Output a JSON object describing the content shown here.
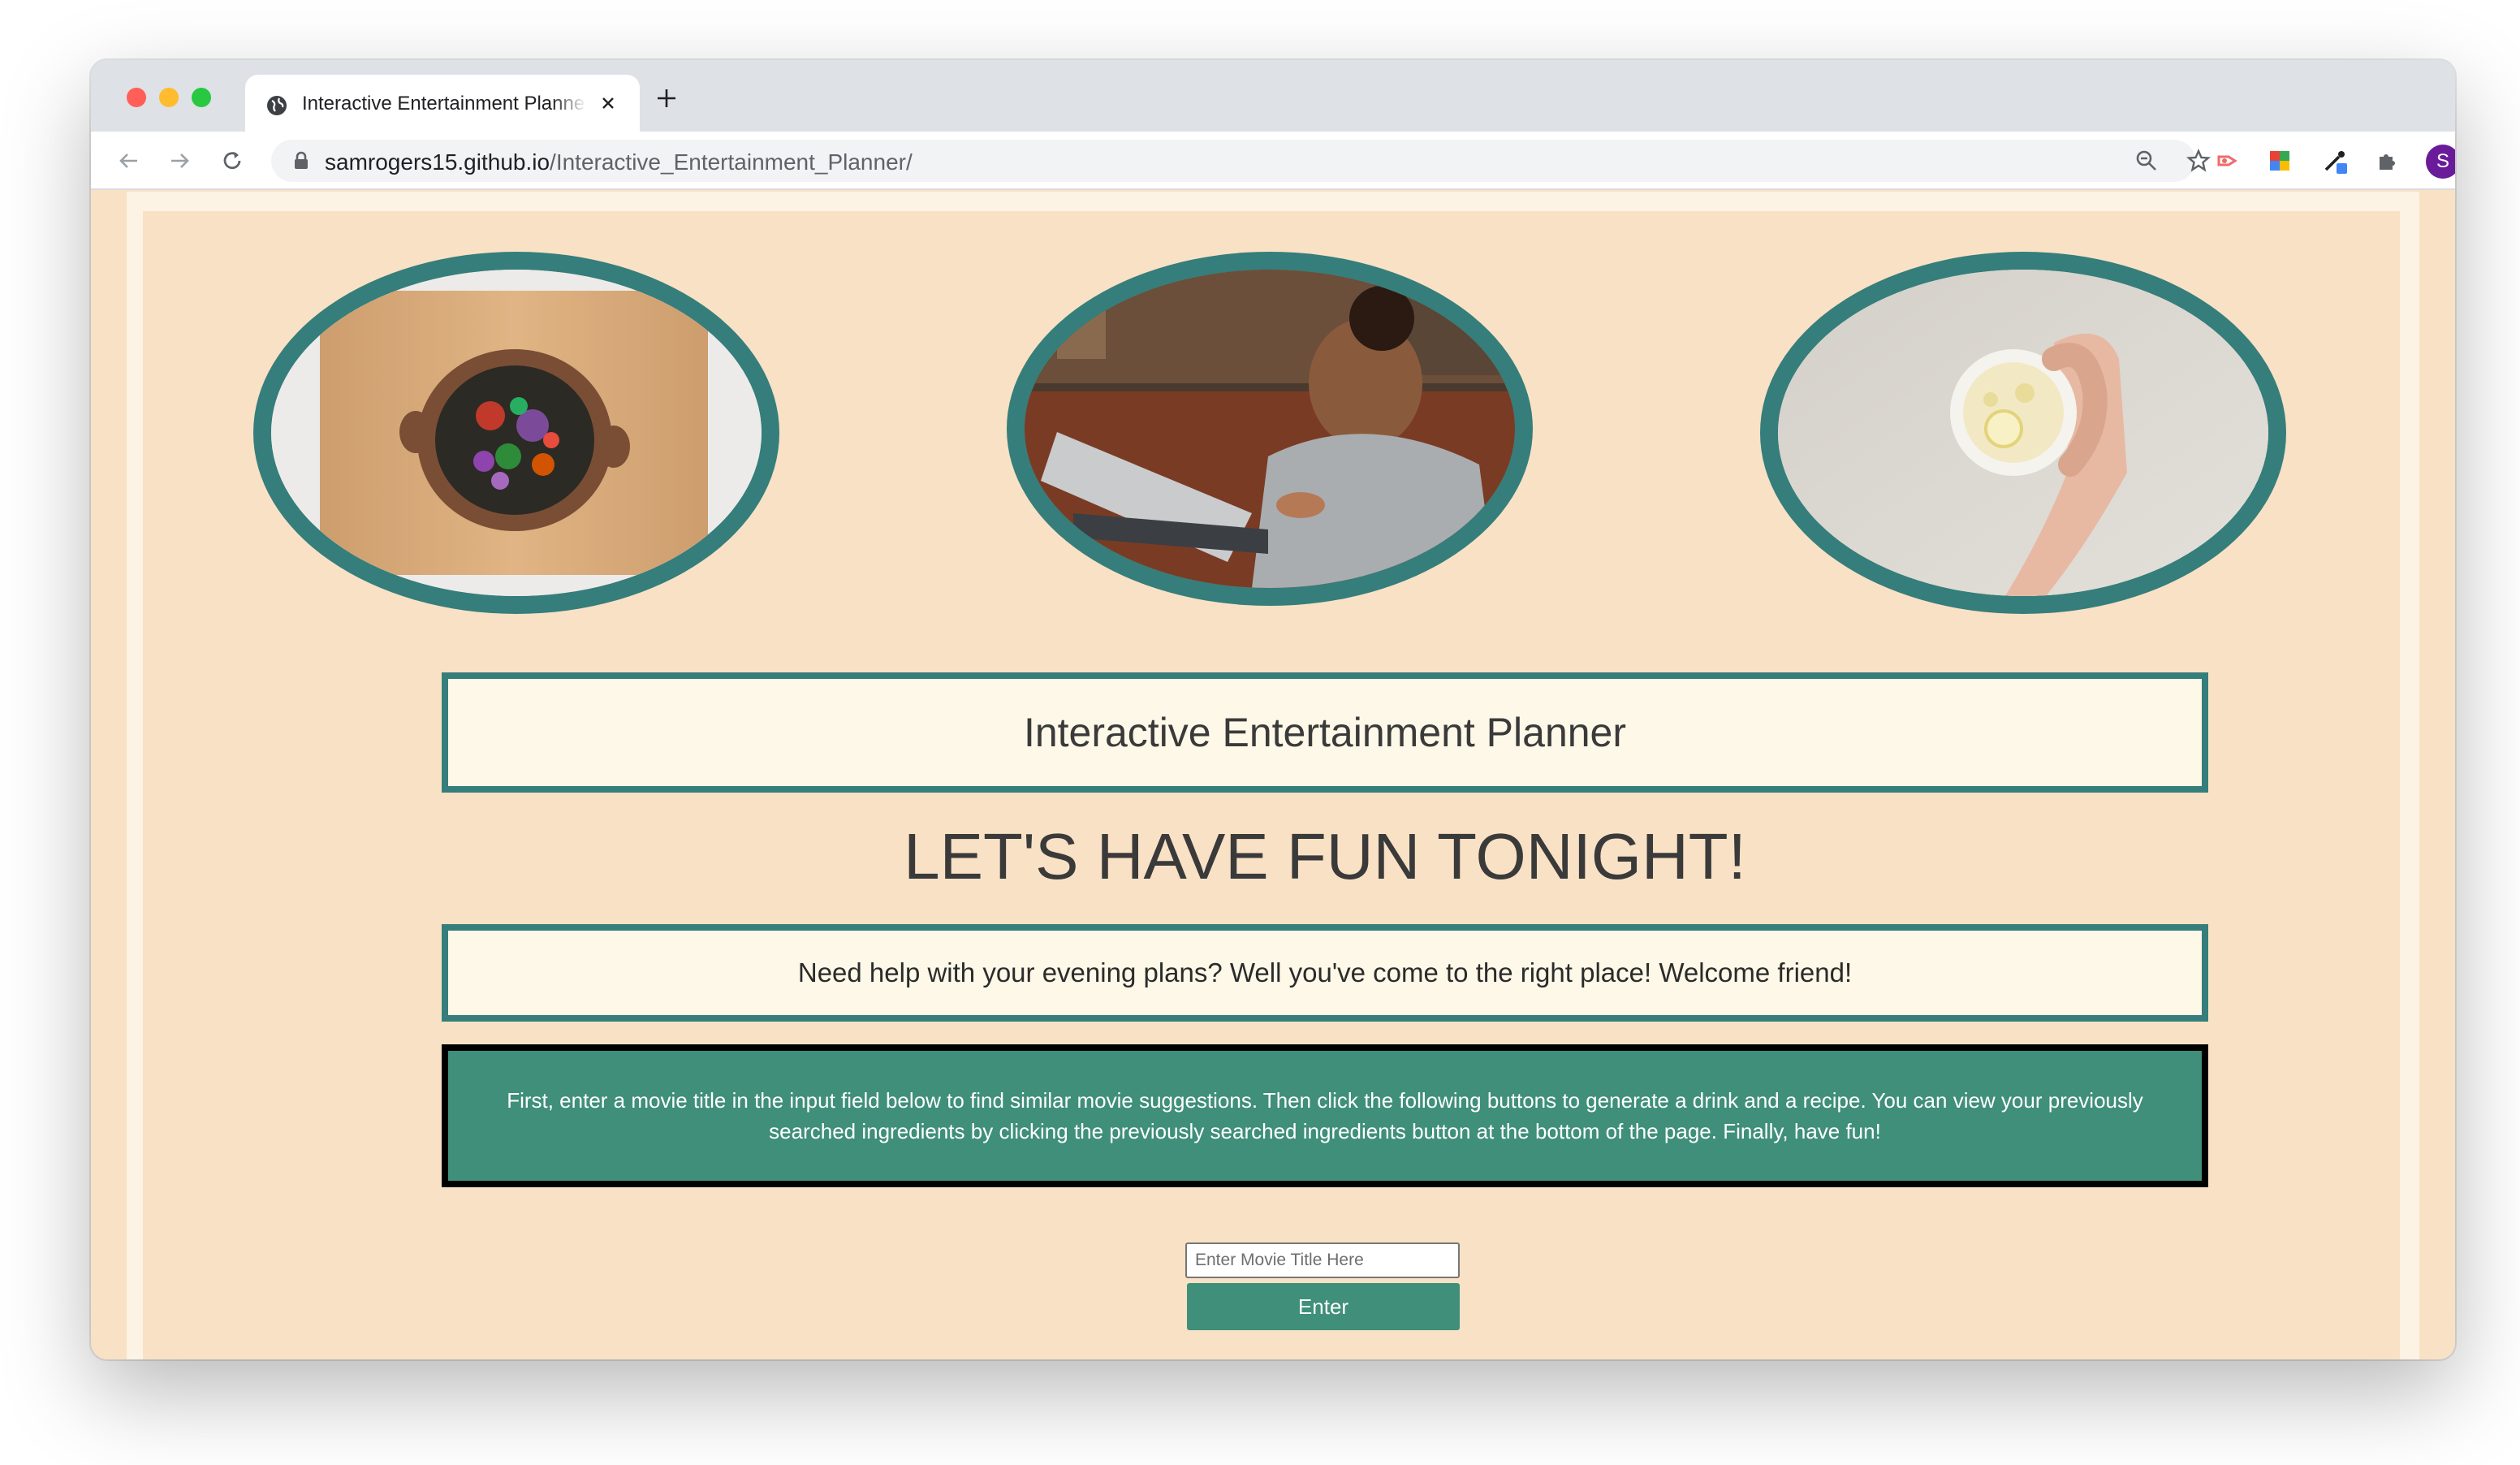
{
  "browser": {
    "tab_title": "Interactive Entertainment Planner",
    "url_host": "samrogers15.github.io",
    "url_path": "/Interactive_Entertainment_Planner/",
    "profile_initial": "S"
  },
  "hero_images": [
    {
      "alt": "salad-bowl-photo"
    },
    {
      "alt": "woman-with-laptop-photo"
    },
    {
      "alt": "lemon-tea-cup-photo"
    }
  ],
  "page": {
    "title": "Interactive Entertainment Planner",
    "headline": "LET'S HAVE FUN TONIGHT!",
    "welcome": "Need help with your evening plans? Well you've come to the right place! Welcome friend!",
    "instructions": "First, enter a movie title in the input field below to find similar movie suggestions. Then click the following buttons to generate a drink and a recipe. You can view your previously searched ingredients by clicking the previously searched ingredients button at the bottom of the page. Finally, have fun!"
  },
  "search": {
    "placeholder": "Enter Movie Title Here",
    "button_label": "Enter"
  },
  "colors": {
    "page_bg": "#f9e1c5",
    "teal": "#357e7b",
    "button_green": "#3f8f7a",
    "box_bg": "#fdf8e8"
  }
}
